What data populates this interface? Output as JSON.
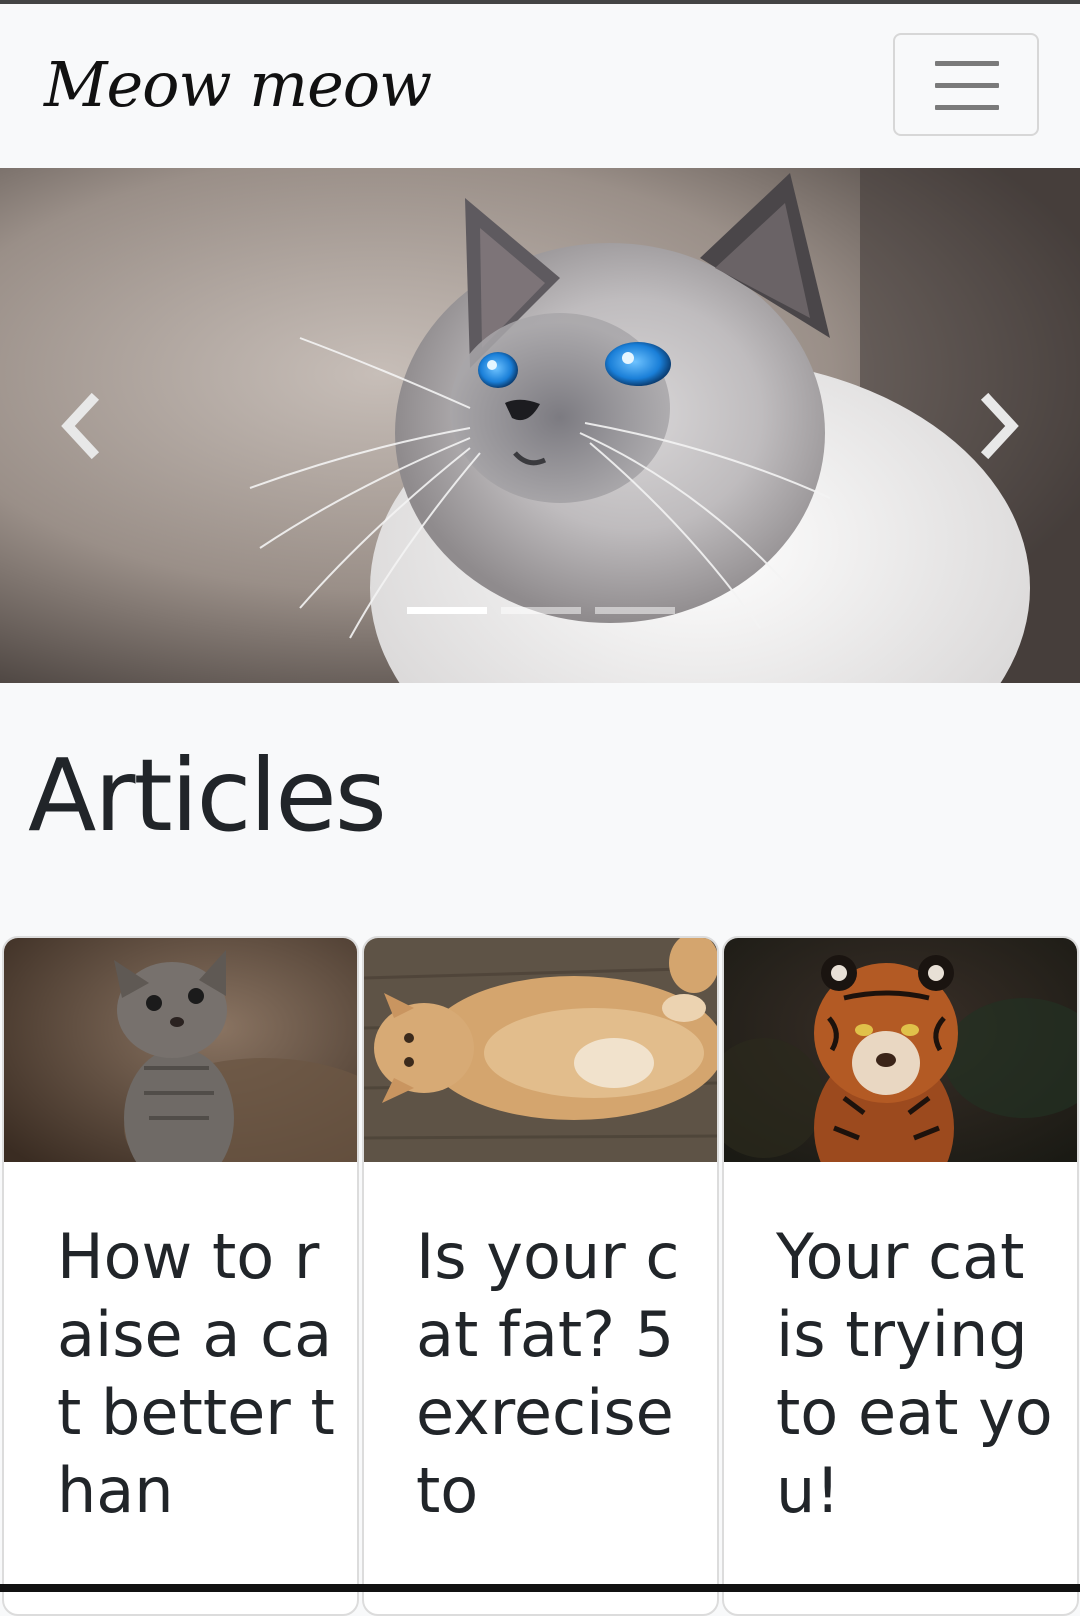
{
  "navbar": {
    "brand": "Meow meow",
    "toggler_icon": "hamburger-menu-icon"
  },
  "carousel": {
    "prev_icon": "chevron-left-icon",
    "next_icon": "chevron-right-icon",
    "slide_count": 3,
    "active_slide": 1,
    "image": "siamese-cat-blue-eyes-photo"
  },
  "articles": {
    "heading": "Articles",
    "cards": [
      {
        "image": "gray-kitten-photo",
        "title": "How to raise a cat better than"
      },
      {
        "image": "orange-fat-cat-photo",
        "title": "Is your cat fat? 5 exrecise to"
      },
      {
        "image": "tiger-photo",
        "title": "Your cat is trying to eat you!"
      }
    ]
  },
  "colors": {
    "background": "#f8f9fa",
    "text": "#212529",
    "border": "#dcdcdc"
  }
}
